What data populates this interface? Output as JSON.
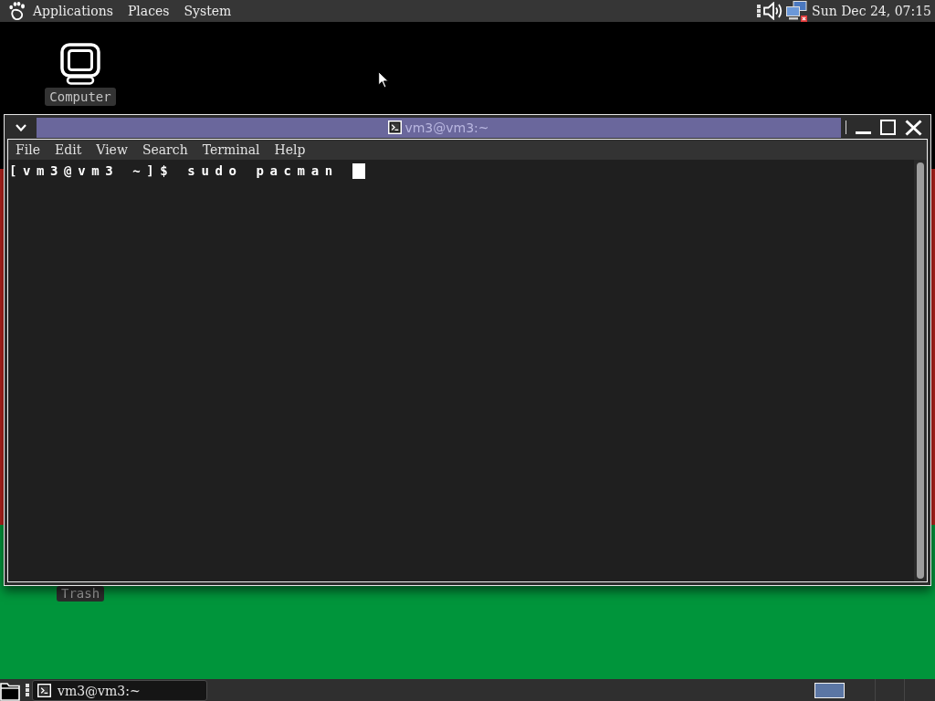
{
  "top_panel": {
    "menus": [
      "Applications",
      "Places",
      "System"
    ],
    "clock": "Sun Dec 24, 07:15"
  },
  "desktop": {
    "icons": [
      {
        "kind": "computer",
        "label": "Computer"
      },
      {
        "kind": "trash",
        "label": "Trash"
      }
    ]
  },
  "terminal_window": {
    "title": "vm3@vm3:~",
    "menu": [
      "File",
      "Edit",
      "View",
      "Search",
      "Terminal",
      "Help"
    ],
    "lines": [
      "[vm3@vm3 ~]$ sudo pacman"
    ]
  },
  "bottom_panel": {
    "tasks": [
      {
        "label": "vm3@vm3:~"
      }
    ],
    "workspaces": [
      {
        "selected": true
      }
    ]
  }
}
